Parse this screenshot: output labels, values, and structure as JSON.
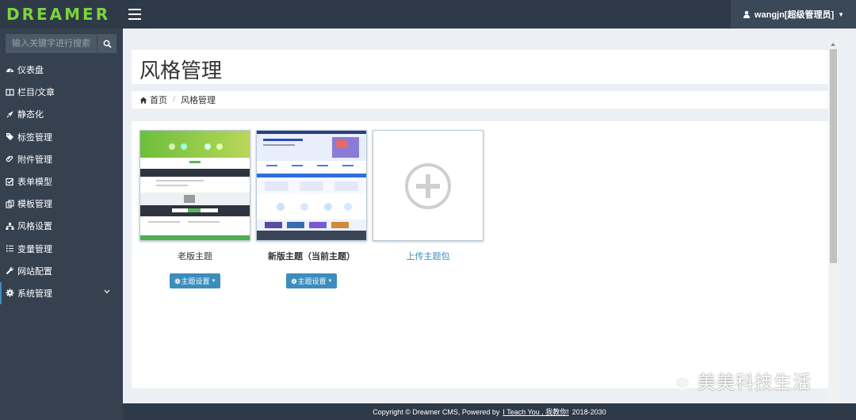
{
  "app": {
    "logo_text": "DREAMER",
    "brand_color": "#7bd43b",
    "accent_color": "#3c8dbc"
  },
  "header": {
    "user_label": "wangjn[超级管理员]"
  },
  "sidebar": {
    "search_placeholder": "输入关键字进行搜索",
    "items": [
      {
        "label": "仪表盘",
        "icon": "dashboard-icon"
      },
      {
        "label": "栏目/文章",
        "icon": "columns-icon"
      },
      {
        "label": "静态化",
        "icon": "rocket-icon"
      },
      {
        "label": "标签管理",
        "icon": "tags-icon"
      },
      {
        "label": "附件管理",
        "icon": "paperclip-icon"
      },
      {
        "label": "表单模型",
        "icon": "checkbox-icon"
      },
      {
        "label": "模板管理",
        "icon": "template-icon"
      },
      {
        "label": "风格设置",
        "icon": "sitemap-icon"
      },
      {
        "label": "变量管理",
        "icon": "list-icon"
      },
      {
        "label": "网站配置",
        "icon": "wrench-icon"
      },
      {
        "label": "系统管理",
        "icon": "gear-icon"
      }
    ]
  },
  "main": {
    "page_title": "风格管理",
    "breadcrumb": {
      "home": "首页",
      "current": "风格管理"
    },
    "themes": [
      {
        "name": "老版主题",
        "button_label": "主题设置"
      },
      {
        "name": "新版主题（当前主题）",
        "button_label": "主题设置"
      }
    ],
    "upload_label": "上传主题包"
  },
  "footer": {
    "prefix": "Copyright © Dreamer CMS, Powered by",
    "link": "I Teach You , 我教你!",
    "years": "2018-2030"
  },
  "watermark": {
    "text": "美美科技生活"
  }
}
